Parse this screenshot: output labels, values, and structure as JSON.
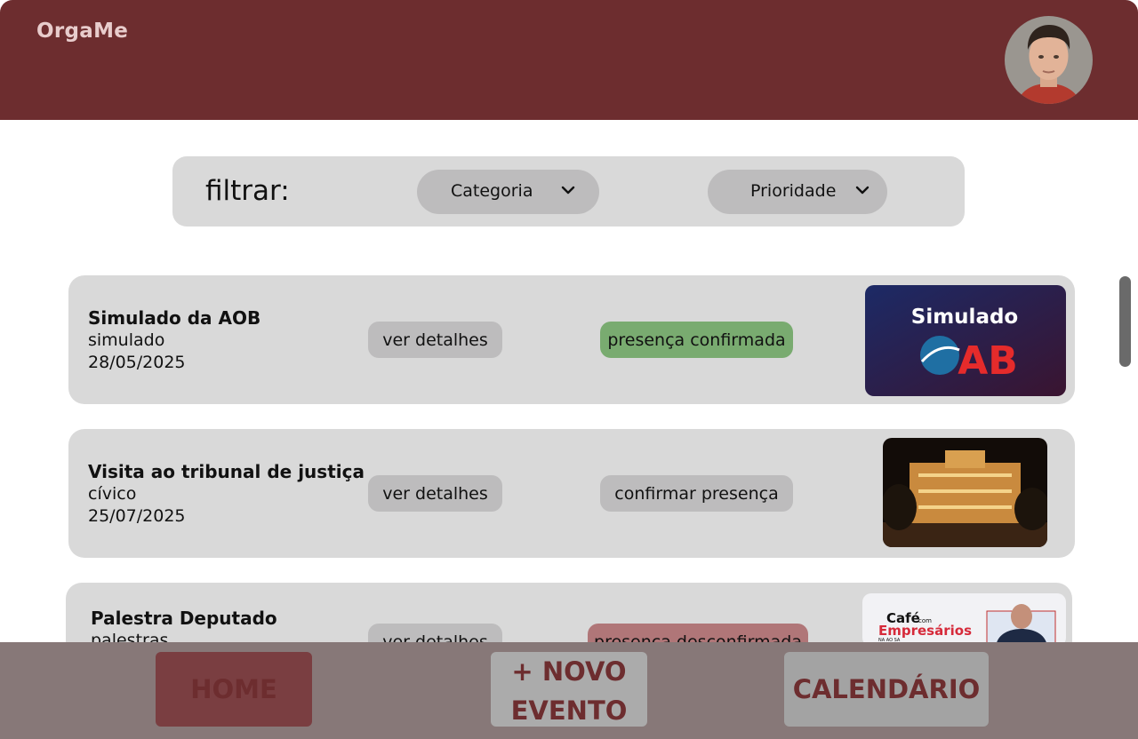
{
  "app": {
    "name": "OrgaMe"
  },
  "filter": {
    "label": "filtrar:",
    "category": "Categoria",
    "priority": "Prioridade"
  },
  "events": [
    {
      "title": "Simulado da AOB",
      "category": "simulado",
      "date": "28/05/2025",
      "details_label": "ver detalhes",
      "status_label": "presença confirmada",
      "status": "confirmed",
      "image_text": "Simulado",
      "image_logo": "AB"
    },
    {
      "title": "Visita ao tribunal de justiça",
      "category": "cívico",
      "date": "25/07/2025",
      "details_label": "ver detalhes",
      "status_label": "confirmar presença",
      "status": "pending"
    },
    {
      "title": "Palestra Deputado",
      "category": "palestras",
      "date": "",
      "details_label": "ver detalhes",
      "status_label": "presença desconfirmada",
      "status": "unconfirmed",
      "image_text_1": "Café",
      "image_text_2": "com",
      "image_text_3": "Empresários",
      "image_text_4": "NA AO SA"
    }
  ],
  "nav": {
    "home": "HOME",
    "new_line1": "+ NOVO",
    "new_line2": "EVENTO",
    "calendar": "CALENDÁRIO"
  },
  "colors": {
    "header": "#6d2d2f",
    "confirmed": "#79ab70",
    "unconfirmed": "#b07678",
    "nav_bg": "#877878",
    "nav_text": "#6d2d2f"
  }
}
